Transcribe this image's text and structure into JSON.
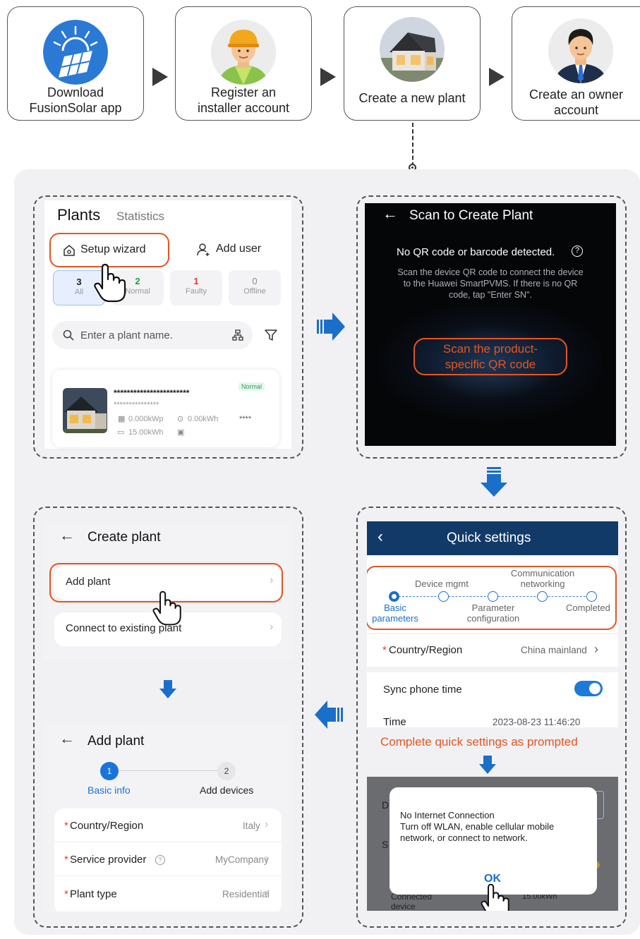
{
  "steps": [
    {
      "label": "Download FusionSolar app",
      "line1": "Download",
      "line2": "FusionSolar app",
      "icon": "solar-panel-icon"
    },
    {
      "label": "Register an installer account",
      "line1": "Register an",
      "line2": "installer account",
      "icon": "installer-avatar-icon"
    },
    {
      "label": "Create a new plant",
      "line1": "Create a new plant",
      "icon": "house-icon"
    },
    {
      "label": "Create an owner account",
      "line1": "Create an owner",
      "line2": "account",
      "icon": "owner-avatar-icon"
    }
  ],
  "plants_screen": {
    "title": "Plants",
    "tab_statistics": "Statistics",
    "setup_wizard": "Setup wizard",
    "add_user": "Add user",
    "filters": [
      {
        "count": "3",
        "label": "All"
      },
      {
        "count": "2",
        "label": "Normal"
      },
      {
        "count": "1",
        "label": "Faulty"
      },
      {
        "count": "0",
        "label": "Offline"
      }
    ],
    "search_placeholder": "Enter a plant name.",
    "plant_card": {
      "name": "***********************",
      "address": "***************",
      "badge": "Normal",
      "power": "0.000kWp",
      "energy": "0.00kWh",
      "stars": "****",
      "capacity": "15.00kWh"
    }
  },
  "scan_screen": {
    "title": "Scan to Create Plant",
    "status": "No QR code or barcode detected.",
    "help_line1": "Scan the device QR code to connect the device",
    "help_line2": "to the Huawei SmartPVMS. If there is no QR",
    "help_line3": "code, tap \"Enter SN\".",
    "scan_button_line1": "Scan the product-",
    "scan_button_line2": "specific QR code"
  },
  "quick_settings": {
    "title": "Quick settings",
    "steps": {
      "device_mgmt": "Device mgmt",
      "comm_line1": "Communication",
      "comm_line2": "networking",
      "basic_line1": "Basic",
      "basic_line2": "parameters",
      "param_line1": "Parameter",
      "param_line2": "configuration",
      "completed": "Completed"
    },
    "country_label": "Country/Region",
    "country_value": "China mainland",
    "sync_label": "Sync phone time",
    "sync_on": true,
    "time_label": "Time",
    "time_value": "2023-08-23 11:46:20",
    "prompt": "Complete quick settings as prompted",
    "dialog_title": "No Internet Connection",
    "dialog_line1": "Turn off WLAN, enable cellular mobile",
    "dialog_line2": "network, or connect to network.",
    "dialog_ok": "OK",
    "bg_label_d": "D",
    "bg_label_s": "S",
    "bg_connected_line1": "Connected",
    "bg_connected_line2": "device",
    "bg_value": "15.00kWh"
  },
  "create_plant": {
    "title": "Create plant",
    "add_plant": "Add plant",
    "connect_existing": "Connect to existing plant"
  },
  "add_plant": {
    "title": "Add plant",
    "step1_num": "1",
    "step1_label": "Basic info",
    "step2_num": "2",
    "step2_label": "Add devices",
    "required_mark": "*",
    "fields": [
      {
        "label": "Country/Region",
        "value": "Italy"
      },
      {
        "label": "Service provider",
        "value": "MyCompany"
      },
      {
        "label": "Plant type",
        "value": "Residential"
      }
    ]
  },
  "colors": {
    "accent": "#e8531f",
    "primary_blue": "#1a73d9",
    "header_navy": "#123a69",
    "arrow_blue": "#1a6fc9"
  }
}
